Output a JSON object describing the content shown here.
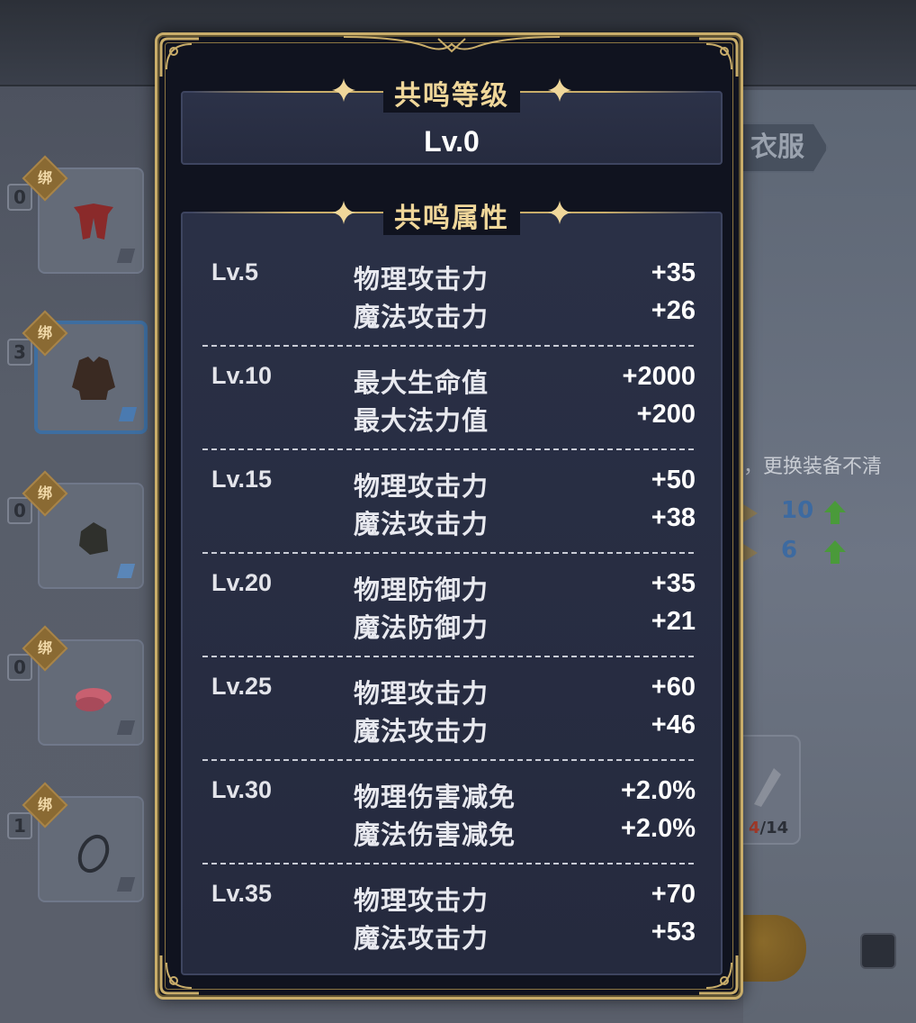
{
  "background": {
    "clothes_tab": "衣服",
    "notice_text": "，更换装备不清",
    "stats": [
      {
        "value": "10"
      },
      {
        "value": "6"
      }
    ],
    "material": {
      "current": "4",
      "total": "/14"
    },
    "slots": [
      {
        "count": "0",
        "badge": "绑",
        "icon": "red-outfit-icon"
      },
      {
        "count": "3",
        "badge": "绑",
        "icon": "leather-jacket-icon"
      },
      {
        "count": "0",
        "badge": "绑",
        "icon": "glove-icon"
      },
      {
        "count": "0",
        "badge": "绑",
        "icon": "pink-shoes-icon"
      },
      {
        "count": "1",
        "badge": "绑",
        "icon": "silver-ring-icon"
      }
    ]
  },
  "modal": {
    "resonance_level_title": "共鸣等级",
    "resonance_level_value": "Lv.0",
    "resonance_attr_title": "共鸣属性",
    "groups": [
      {
        "level": "Lv.5",
        "attrs": [
          {
            "name": "物理攻击力",
            "value": "+35"
          },
          {
            "name": "魔法攻击力",
            "value": "+26"
          }
        ]
      },
      {
        "level": "Lv.10",
        "attrs": [
          {
            "name": "最大生命值",
            "value": "+2000"
          },
          {
            "name": "最大法力值",
            "value": "+200"
          }
        ]
      },
      {
        "level": "Lv.15",
        "attrs": [
          {
            "name": "物理攻击力",
            "value": "+50"
          },
          {
            "name": "魔法攻击力",
            "value": "+38"
          }
        ]
      },
      {
        "level": "Lv.20",
        "attrs": [
          {
            "name": "物理防御力",
            "value": "+35"
          },
          {
            "name": "魔法防御力",
            "value": "+21"
          }
        ]
      },
      {
        "level": "Lv.25",
        "attrs": [
          {
            "name": "物理攻击力",
            "value": "+60"
          },
          {
            "name": "魔法攻击力",
            "value": "+46"
          }
        ]
      },
      {
        "level": "Lv.30",
        "attrs": [
          {
            "name": "物理伤害减免",
            "value": "+2.0%"
          },
          {
            "name": "魔法伤害减免",
            "value": "+2.0%"
          }
        ]
      },
      {
        "level": "Lv.35",
        "attrs": [
          {
            "name": "物理攻击力",
            "value": "+70"
          },
          {
            "name": "魔法攻击力",
            "value": "+53"
          }
        ]
      }
    ]
  },
  "colors": {
    "gold": "#c9ad6a",
    "title_gold": "#f0d79a",
    "panel_bg": "#10131f",
    "box_bg": "#2a3046",
    "stat_blue": "#3d6aa0",
    "arrow_green": "#4a9a3a"
  }
}
